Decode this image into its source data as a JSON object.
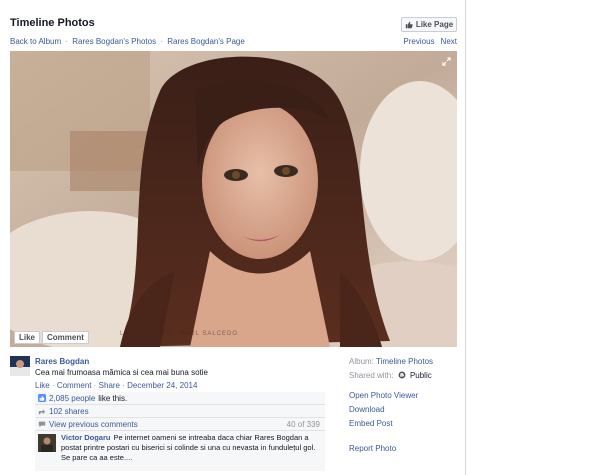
{
  "header": {
    "title": "Timeline Photos",
    "like_page": "Like Page"
  },
  "breadcrumb": [
    "Back to Album",
    "Rares Bogdan's Photos",
    "Rares Bogdan's Page"
  ],
  "breadcrumb_sep": "·",
  "nav": {
    "previous": "Previous",
    "next": "Next"
  },
  "photo": {
    "like_label": "Like",
    "comment_label": "Comment",
    "watermark": "LAURA BALCU - PAUL SALCEDO"
  },
  "post": {
    "author": "Rares Bogdan",
    "caption": "Cea mai frumoasa mămica si cea mai buna sotie",
    "like": "Like",
    "comment": "Comment",
    "share": "Share",
    "sep": "·",
    "date": "December 24, 2014"
  },
  "ufi": {
    "likes_link": "2,085 people",
    "likes_rest": "like this.",
    "shares": "102 shares",
    "view_previous": "View previous comments",
    "comment_count": "40 of 339"
  },
  "comment": {
    "author": "Victor Dogaru",
    "text": "Pe internet oameni se intreaba daca chiar Rares Bogdan a postat printre postari cu biserici si colinde si una cu nevasta in fundulețul gol. Se pare ca aa este...."
  },
  "sidebar": {
    "album_label": "Album:",
    "album_name": "Timeline Photos",
    "shared_label": "Shared with:",
    "shared_value": "Public",
    "menu": [
      "Open Photo Viewer",
      "Download",
      "Embed Post",
      "Report Photo"
    ]
  },
  "colors": {
    "link": "#3b5998",
    "muted": "#90949c",
    "ufi_bg": "#f6f7f9"
  }
}
